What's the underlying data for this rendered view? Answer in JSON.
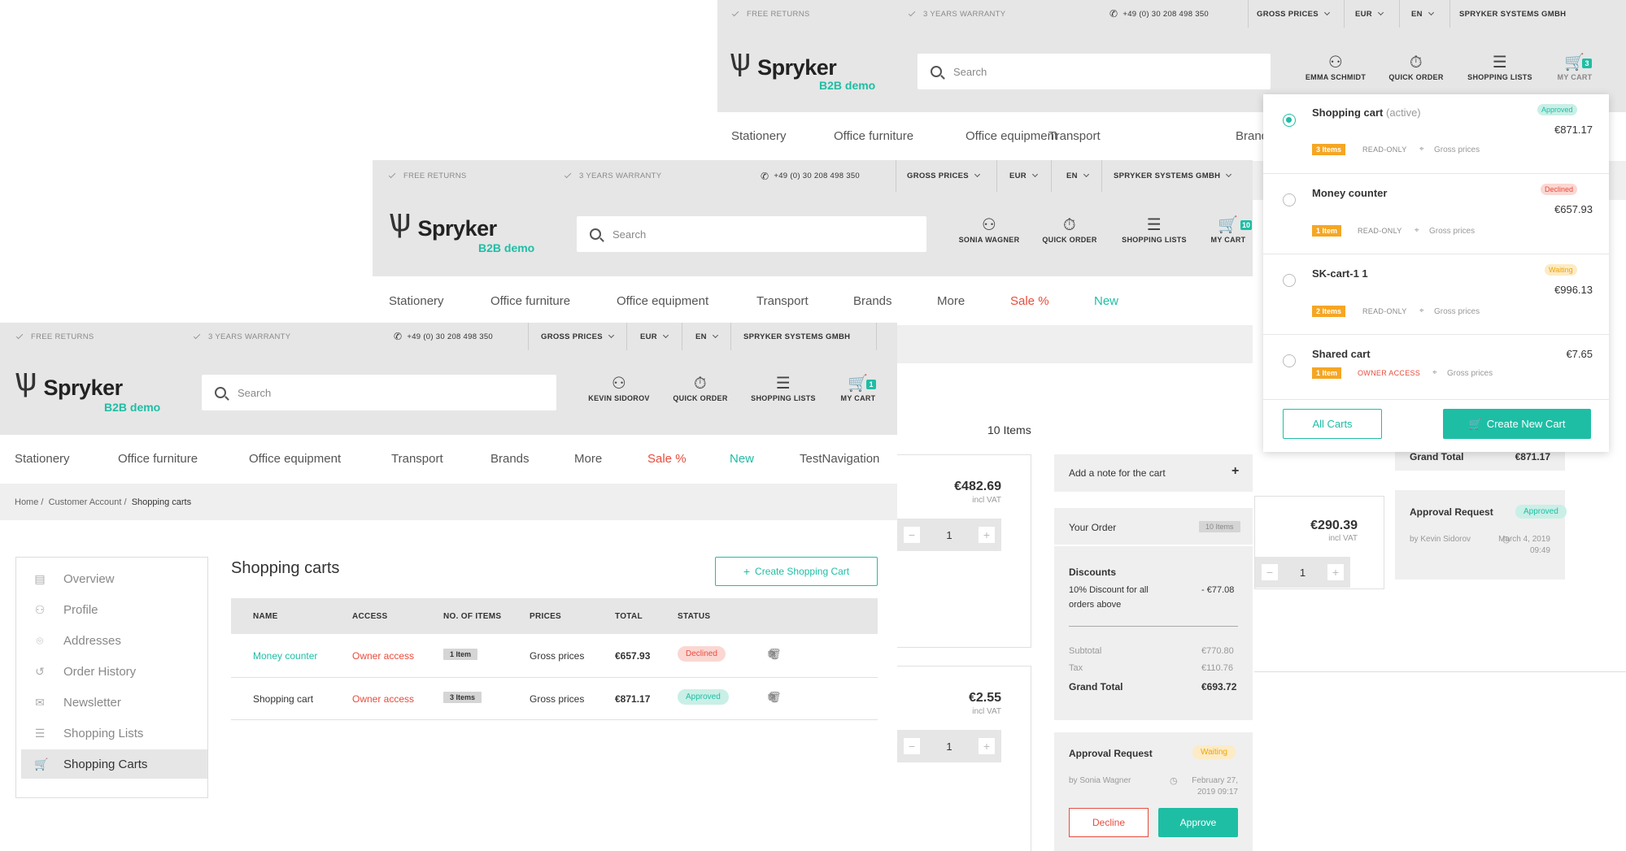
{
  "common": {
    "free_returns": "FREE RETURNS",
    "warranty": "3 YEARS WARRANTY",
    "phone": "+49 (0) 30 208 498 350",
    "gross_prices": "GROSS PRICES",
    "currency": "EUR",
    "language": "EN",
    "company": "SPRYKER SYSTEMS GMBH",
    "logo_word": "Spryker",
    "logo_sub": "B2B demo",
    "search_placeholder": "Search",
    "quick_order": "QUICK ORDER",
    "shopping_lists": "SHOPPING LISTS",
    "my_cart": "MY CART"
  },
  "nav": {
    "stationery": "Stationery",
    "office_furniture": "Office furniture",
    "office_equipment": "Office equipment",
    "transport": "Transport",
    "brands": "Brands",
    "more": "More",
    "sale": "Sale %",
    "new": "New",
    "test_navigation": "TestNavigation"
  },
  "window_back": {
    "user": "EMMA SCHMIDT",
    "cart_count": "3",
    "dropdown": {
      "carts": [
        {
          "name": "Shopping cart",
          "suffix": "(active)",
          "status": "Approved",
          "price": "€871.17",
          "items": "3 Items",
          "access": "READ-ONLY",
          "prices": "Gross prices"
        },
        {
          "name": "Money counter",
          "status": "Declined",
          "price": "€657.93",
          "items": "1 Item",
          "access": "READ-ONLY",
          "prices": "Gross prices"
        },
        {
          "name": "SK-cart-1 1",
          "status": "Waiting",
          "price": "€996.13",
          "items": "2 Items",
          "access": "READ-ONLY",
          "prices": "Gross prices"
        },
        {
          "name": "Shared cart",
          "price": "€7.65",
          "items": "1 Item",
          "access": "OWNER ACCESS",
          "prices": "Gross prices"
        }
      ],
      "all_carts": "All Carts",
      "create_new_cart": "Create New Cart"
    },
    "grand_total_label": "Grand Total",
    "grand_total_value": "€871.17",
    "approval_request": "Approval Request",
    "approval_status": "Approved",
    "approval_by": "by Kevin Sidorov",
    "approval_date": "March 4, 2019",
    "approval_time": "09:49",
    "item_price": "€290.39",
    "incl_vat": "incl VAT",
    "qty": "1"
  },
  "window_mid": {
    "user": "SONIA WAGNER",
    "cart_count": "10",
    "items_count": "10 Items",
    "item1_price": "€482.69",
    "item2_price": "€2.55",
    "incl_vat": "incl VAT",
    "qty": "1",
    "add_note": "Add a note for the cart",
    "your_order": "Your Order",
    "order_items": "10 Items",
    "discounts": "Discounts",
    "discount_desc_1": "10% Discount for all",
    "discount_desc_2": "orders above",
    "discount_value": "- €77.08",
    "subtotal_label": "Subtotal",
    "subtotal_value": "€770.80",
    "tax_label": "Tax",
    "tax_value": "€110.76",
    "grand_total_label": "Grand Total",
    "grand_total_value": "€693.72",
    "approval_request": "Approval Request",
    "approval_status": "Waiting",
    "approval_by": "by Sonia Wagner",
    "approval_date": "February 27,",
    "approval_time": "2019 09:17",
    "decline": "Decline",
    "approve": "Approve"
  },
  "window_front": {
    "user": "KEVIN SIDOROV",
    "cart_count": "1",
    "breadcrumb": {
      "home": "Home /",
      "account": "Customer Account /",
      "current": "Shopping carts"
    },
    "sidebar": [
      "Overview",
      "Profile",
      "Addresses",
      "Order History",
      "Newsletter",
      "Shopping Lists",
      "Shopping Carts"
    ],
    "title": "Shopping carts",
    "create_button": "Create Shopping Cart",
    "table": {
      "headers": [
        "NAME",
        "ACCESS",
        "NO. OF ITEMS",
        "PRICES",
        "TOTAL",
        "STATUS"
      ],
      "rows": [
        {
          "name": "Money counter",
          "access": "Owner access",
          "items": "1 Item",
          "prices": "Gross prices",
          "total": "€657.93",
          "status": "Declined"
        },
        {
          "name": "Shopping cart",
          "access": "Owner access",
          "items": "3 Items",
          "prices": "Gross prices",
          "total": "€871.17",
          "status": "Approved"
        }
      ]
    }
  },
  "colors": {
    "accent": "#1ebea5",
    "danger": "#e84c3d",
    "warning": "#f5a623",
    "topbar": "#e6e6e6"
  }
}
